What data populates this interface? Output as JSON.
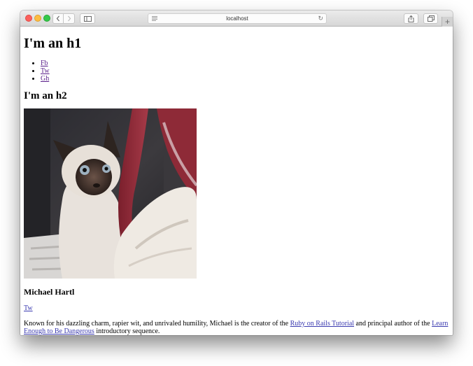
{
  "browser": {
    "address": "localhost",
    "back_icon": "chevron-left-icon",
    "forward_icon": "chevron-right-icon",
    "sidebar_icon": "sidebar-icon",
    "share_icon": "share-icon",
    "tabs_icon": "tabs-icon",
    "new_tab_icon": "plus-icon",
    "reader_icon": "reader-icon",
    "reload_icon": "reload-icon"
  },
  "page": {
    "h1": "I'm an h1",
    "social_links": [
      {
        "label": "Fb"
      },
      {
        "label": "Tw"
      },
      {
        "label": "Gh"
      }
    ],
    "h2": "I'm an h2",
    "image": "photo of a Siamese cat next to a red and white bag",
    "name": "Michael Hartl",
    "twitter_link": "Tw",
    "bio": {
      "text_1": "Known for his dazzling charm, rapier wit, and unrivaled humility, Michael is the creator of the ",
      "link_1": "Ruby on Rails Tutorial",
      "text_2": " and principal author of the ",
      "link_2": "Learn Enough to Be Dangerous",
      "text_3": " introductory sequence."
    }
  },
  "colors": {
    "link": "#3b3bb0",
    "visited_link": "#5a1e8a",
    "close": "#fc605c",
    "minimize": "#fdbc40",
    "zoom": "#34c84a"
  }
}
